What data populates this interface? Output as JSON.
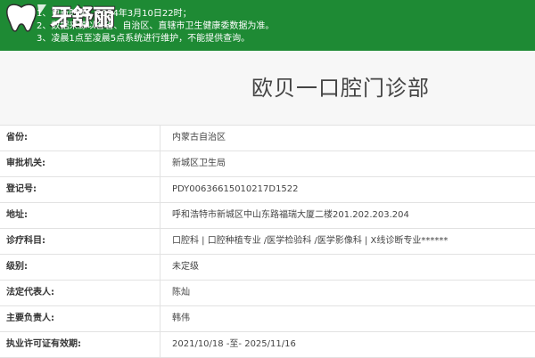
{
  "logo": {
    "text": "牙舒丽"
  },
  "notice": {
    "lines": [
      "1、更新时间：2024年3月10日22时；",
      "2、数据来源以各省、自治区、直辖市卫生健康委数据为准。",
      "3、凌晨1点至凌晨5点系统进行维护，不能提供查询。"
    ]
  },
  "page": {
    "title": "欧贝一口腔门诊部"
  },
  "info": {
    "rows": [
      {
        "label": "省份:",
        "value": "内蒙古自治区"
      },
      {
        "label": "审批机关:",
        "value": "新城区卫生局"
      },
      {
        "label": "登记号:",
        "value": "PDY00636615010217D1522"
      },
      {
        "label": "地址:",
        "value": "呼和浩特市新城区中山东路福瑞大厦二楼201.202.203.204"
      },
      {
        "label": "诊疗科目:",
        "value": "口腔科 | 口腔种植专业 /医学检验科 /医学影像科 | X线诊断专业******"
      },
      {
        "label": "级别:",
        "value": "未定级"
      },
      {
        "label": "法定代表人:",
        "value": "陈灿"
      },
      {
        "label": "主要负责人:",
        "value": "韩伟"
      },
      {
        "label": "执业许可证有效期:",
        "value": "2021/10/18 -至- 2025/11/16"
      }
    ]
  },
  "colors": {
    "notice_bg": "#1e8a34",
    "page_bg": "#f7f7f7",
    "row_border": "#e2e2e2"
  }
}
